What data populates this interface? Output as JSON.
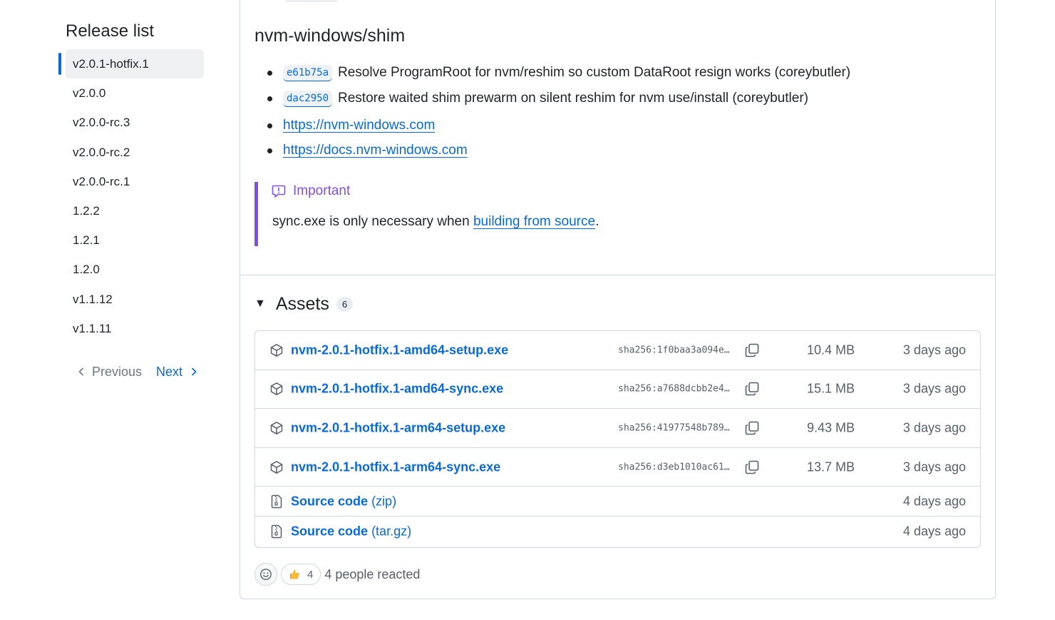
{
  "sidebar": {
    "title": "Release list",
    "releases": [
      "v2.0.1-hotfix.1",
      "v2.0.0",
      "v2.0.0-rc.3",
      "v2.0.0-rc.2",
      "v2.0.0-rc.1",
      "1.2.2",
      "1.2.1",
      "1.2.0",
      "v1.1.12",
      "v1.1.11"
    ],
    "selected": "v2.0.1-hotfix.1",
    "pagination": {
      "previous": "Previous",
      "next": "Next"
    }
  },
  "release": {
    "section_heading": "nvm-windows/shim",
    "commits": [
      {
        "sha": "e61b75a",
        "message": "Resolve ProgramRoot for nvm/reshim so custom DataRoot resign works (coreybutler)"
      },
      {
        "sha": "dac2950",
        "message": "Restore waited shim prewarm on silent reshim for nvm use/install (coreybutler)"
      }
    ],
    "links": [
      "https://nvm-windows.com",
      "https://docs.nvm-windows.com"
    ],
    "callout": {
      "title": "Important",
      "text_before": "sync.exe is only necessary when ",
      "link_text": "building from source",
      "text_after": "."
    }
  },
  "assets": {
    "title": "Assets",
    "count": "6",
    "files": [
      {
        "name": "nvm-2.0.1-hotfix.1-amd64-setup.exe",
        "sha": "sha256:1f0baa3a094e…",
        "size": "10.4 MB",
        "date": "3 days ago"
      },
      {
        "name": "nvm-2.0.1-hotfix.1-amd64-sync.exe",
        "sha": "sha256:a7688dcbb2e4…",
        "size": "15.1 MB",
        "date": "3 days ago"
      },
      {
        "name": "nvm-2.0.1-hotfix.1-arm64-setup.exe",
        "sha": "sha256:41977548b789…",
        "size": "9.43 MB",
        "date": "3 days ago"
      },
      {
        "name": "nvm-2.0.1-hotfix.1-arm64-sync.exe",
        "sha": "sha256:d3eb1010ac61…",
        "size": "13.7 MB",
        "date": "3 days ago"
      }
    ],
    "source": [
      {
        "label": "Source code",
        "format": "(zip)",
        "date": "4 days ago"
      },
      {
        "label": "Source code",
        "format": "(tar.gz)",
        "date": "4 days ago"
      }
    ]
  },
  "reactions": {
    "thumbs_count": "4",
    "summary": "4 people reacted"
  },
  "colors": {
    "link": "#0969da",
    "important": "#8250df",
    "border": "#d0d7de",
    "muted": "#57606a"
  },
  "icons": [
    "package-icon",
    "file-zip-icon",
    "copy-icon",
    "report-icon",
    "smiley-icon",
    "thumbs-up-icon",
    "chevron-left-icon",
    "chevron-right-icon",
    "triangle-down-icon"
  ]
}
